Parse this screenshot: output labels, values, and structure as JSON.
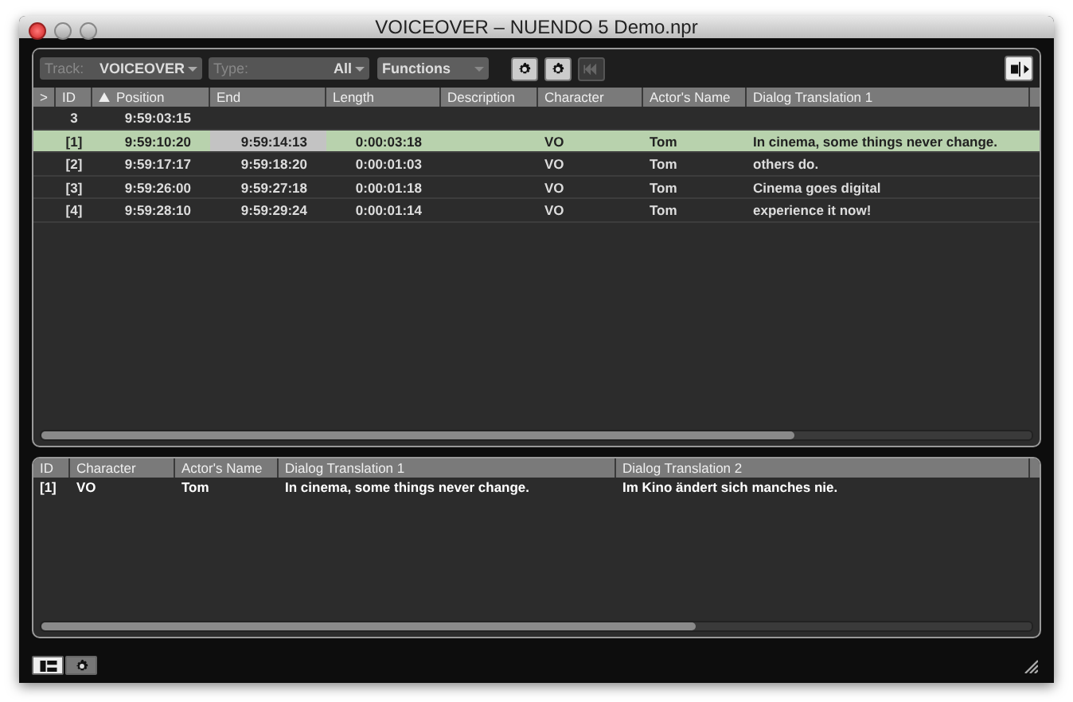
{
  "window": {
    "title": "VOICEOVER – NUENDO 5 Demo.npr"
  },
  "toolbar": {
    "track": {
      "label": "Track:",
      "value": "VOICEOVER"
    },
    "type": {
      "label": "Type:",
      "value": "All"
    },
    "functions": {
      "value": "Functions"
    },
    "rewind_disabled": true
  },
  "table": {
    "columns": [
      ">",
      "ID",
      "Position",
      "End",
      "Length",
      "Description",
      "Character",
      "Actor's Name",
      "Dialog Translation 1"
    ],
    "rows": [
      {
        "selected": false,
        "end_focused": false,
        "cells": [
          "",
          "3",
          "9:59:03:15",
          "",
          "",
          "",
          "",
          "",
          ""
        ]
      },
      {
        "selected": true,
        "end_focused": true,
        "cells": [
          "",
          "[1]",
          "9:59:10:20",
          "9:59:14:13",
          "0:00:03:18",
          "",
          "VO",
          "Tom",
          "In cinema, some things never change."
        ]
      },
      {
        "selected": false,
        "end_focused": false,
        "cells": [
          "",
          "[2]",
          "9:59:17:17",
          "9:59:18:20",
          "0:00:01:03",
          "",
          "VO",
          "Tom",
          "others do."
        ]
      },
      {
        "selected": false,
        "end_focused": false,
        "cells": [
          "",
          "[3]",
          "9:59:26:00",
          "9:59:27:18",
          "0:00:01:18",
          "",
          "VO",
          "Tom",
          "Cinema goes digital"
        ]
      },
      {
        "selected": false,
        "end_focused": false,
        "cells": [
          "",
          "[4]",
          "9:59:28:10",
          "9:59:29:24",
          "0:00:01:14",
          "",
          "VO",
          "Tom",
          "experience it now!"
        ]
      }
    ]
  },
  "detail": {
    "columns": [
      "ID",
      "Character",
      "Actor's Name",
      "Dialog Translation 1",
      "Dialog Translation 2"
    ],
    "rows": [
      {
        "cells": [
          "[1]",
          "VO",
          "Tom",
          "In cinema, some things never change.",
          "Im Kino ändert sich manches nie."
        ]
      }
    ]
  },
  "bottom_tabs": [
    {
      "kind": "list",
      "selected": true
    },
    {
      "kind": "settings",
      "selected": false
    }
  ]
}
